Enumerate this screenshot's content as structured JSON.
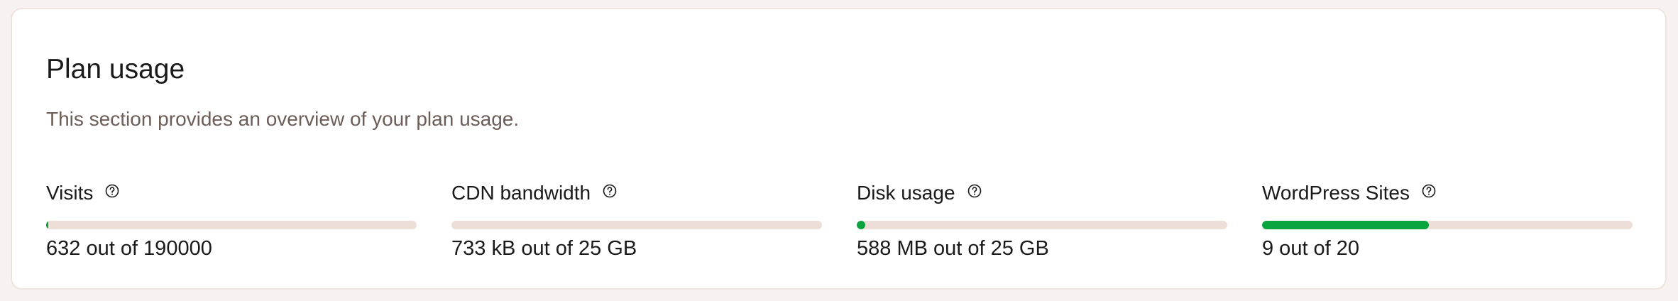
{
  "section": {
    "title": "Plan usage",
    "description": "This section provides an overview of your plan usage."
  },
  "metrics": [
    {
      "label": "Visits",
      "value_text": "632 out of 190000",
      "fraction": 0.0033,
      "info_icon": "question-circle-icon"
    },
    {
      "label": "CDN bandwidth",
      "value_text": "733 kB out of 25 GB",
      "fraction": 0.0,
      "info_icon": "question-circle-icon"
    },
    {
      "label": "Disk usage",
      "value_text": "588 MB out of 25 GB",
      "fraction": 0.0235,
      "info_icon": "question-circle-icon"
    },
    {
      "label": "WordPress Sites",
      "value_text": "9 out of 20",
      "fraction": 0.45,
      "info_icon": "question-circle-icon"
    }
  ],
  "colors": {
    "progress_fill": "#0aa53f",
    "progress_track": "#eddfd8",
    "card_border": "#efe4df",
    "page_background": "#f7f2ef"
  }
}
